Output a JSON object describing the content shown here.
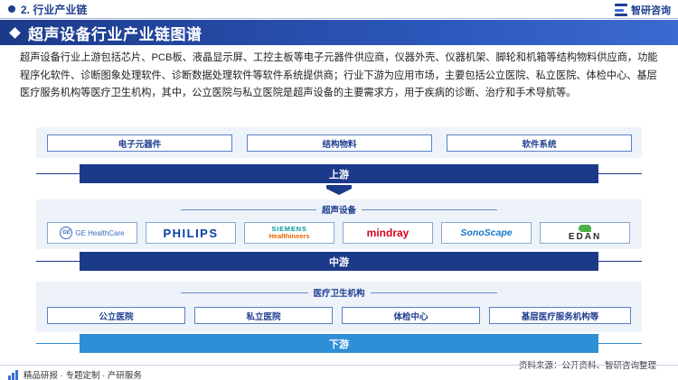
{
  "header": {
    "section_label": "2. 行业产业链",
    "brand_name": "智研咨询"
  },
  "title": "超声设备行业产业链图谱",
  "intro": "超声设备行业上游包括芯片、PCB板、液晶显示屏、工控主板等电子元器件供应商，仪器外壳、仪器机架、脚轮和机箱等结构物料供应商，功能程序化软件、诊断图象处理软件、诊断数据处理软件等软件系统提供商；行业下游为应用市场，主要包括公立医院、私立医院、体检中心、基层医疗服务机构等医疗卫生机构，其中，公立医院与私立医院是超声设备的主要需求方，用于疾病的诊断、治疗和手术导航等。",
  "upstream": {
    "items": [
      "电子元器件",
      "结构物料",
      "软件系统"
    ],
    "stage_label": "上游"
  },
  "midstream": {
    "group_label": "超声设备",
    "logos": [
      {
        "name": "ge-healthcare-logo",
        "text": "GE HealthCare",
        "mark": "GE"
      },
      {
        "name": "philips-logo",
        "text": "PHILIPS"
      },
      {
        "name": "siemens-healthineers-logo",
        "text_top": "SIEMENS",
        "text_bottom": "Healthineers"
      },
      {
        "name": "mindray-logo",
        "text": "mindray"
      },
      {
        "name": "sonoscape-logo",
        "text": "SonoScape"
      },
      {
        "name": "edan-logo",
        "text": "EDAN"
      }
    ],
    "stage_label": "中游"
  },
  "downstream": {
    "group_label": "医疗卫生机构",
    "items": [
      "公立医院",
      "私立医院",
      "体检中心",
      "基层医疗服务机构等"
    ],
    "stage_label": "下游"
  },
  "footer": {
    "left": "精品研报 · 专题定制 · 产研服务",
    "right": "资料来源：公开资料、智研咨询整理"
  },
  "colors": {
    "primary": "#1c3a8a",
    "accent": "#3a6fd8",
    "downstream_bar": "#2e8fd6"
  }
}
